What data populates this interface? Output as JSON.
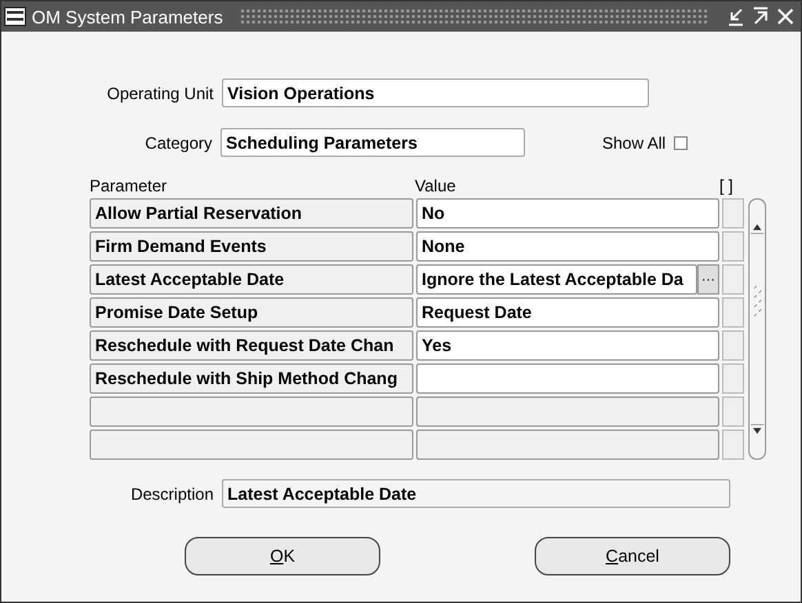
{
  "window": {
    "title": "OM System Parameters"
  },
  "operating_unit": {
    "label": "Operating Unit",
    "value": "Vision Operations"
  },
  "category": {
    "label": "Category",
    "value": "Scheduling Parameters"
  },
  "show_all": {
    "label": "Show All",
    "checked": false
  },
  "table": {
    "columns": [
      "Parameter",
      "Value",
      "[ ]"
    ],
    "rows": [
      {
        "kind": "param",
        "parameter": "Allow Partial Reservation",
        "value": "No",
        "selected": false
      },
      {
        "kind": "param",
        "parameter": "Firm Demand Events",
        "value": "None",
        "selected": false
      },
      {
        "kind": "param",
        "parameter": "Latest Acceptable Date",
        "value": "Ignore the Latest Acceptable Da",
        "selected": true,
        "lov_button": "···"
      },
      {
        "kind": "param",
        "parameter": "Promise Date Setup",
        "value": "Request Date",
        "selected": false
      },
      {
        "kind": "param",
        "parameter": "Reschedule with Request Date Chan",
        "value": "Yes",
        "selected": false
      },
      {
        "kind": "param",
        "parameter": "Reschedule with Ship Method Chang",
        "selected": false
      },
      {
        "kind": "blank",
        "selected": false
      },
      {
        "kind": "blank",
        "selected": false
      }
    ]
  },
  "description": {
    "label": "Description",
    "value": "Latest Acceptable Date"
  },
  "buttons": [
    {
      "label": "OK",
      "mnemonic_underlined": true
    },
    {
      "label": "Cancel",
      "mnemonic_underlined": true
    }
  ]
}
